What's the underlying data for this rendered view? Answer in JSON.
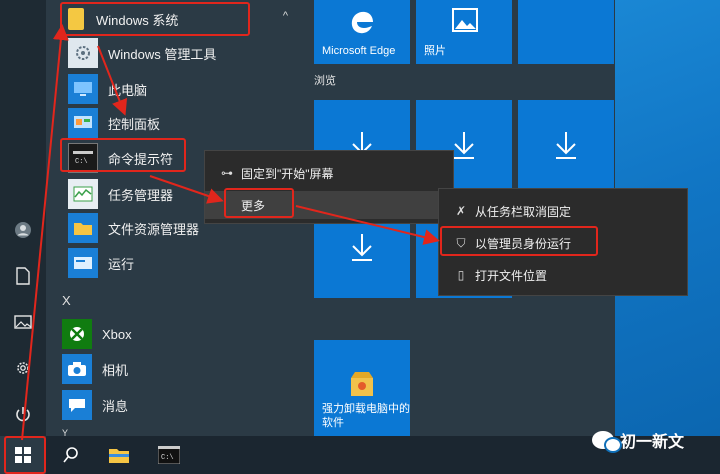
{
  "start_menu": {
    "group_header": "Windows 系统",
    "apps": [
      {
        "label": "Windows 管理工具",
        "icon": "gear-icon"
      },
      {
        "label": "此电脑",
        "icon": "computer-icon"
      },
      {
        "label": "控制面板",
        "icon": "control-panel-icon"
      },
      {
        "label": "命令提示符",
        "icon": "cmd-icon"
      },
      {
        "label": "任务管理器",
        "icon": "task-manager-icon"
      },
      {
        "label": "文件资源管理器",
        "icon": "folder-icon"
      },
      {
        "label": "运行",
        "icon": "run-icon"
      }
    ],
    "section_x": "X",
    "apps_x": [
      {
        "label": "Xbox",
        "icon": "xbox-icon"
      },
      {
        "label": "相机",
        "icon": "camera-icon"
      },
      {
        "label": "消息",
        "icon": "message-icon"
      }
    ],
    "section_y": "Y"
  },
  "tiles": {
    "edge_label": "Microsoft Edge",
    "photos_label": "照片",
    "group_label": "浏览",
    "uninstall_label": "强力卸载电脑中的软件"
  },
  "context_menu": {
    "pin_label": "固定到\"开始\"屏幕",
    "more_label": "更多",
    "submenu": {
      "unpin_taskbar": "从任务栏取消固定",
      "run_as_admin": "以管理员身份运行",
      "open_location": "打开文件位置"
    }
  },
  "watermark": "初一新文",
  "colors": {
    "highlight": "#e1261c",
    "tile": "#0b78d4"
  }
}
